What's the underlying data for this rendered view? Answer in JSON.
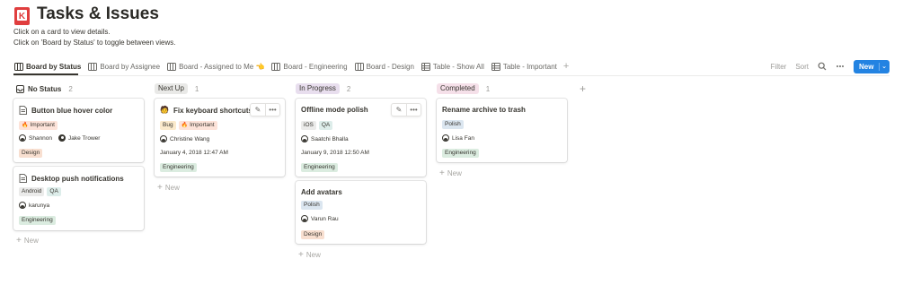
{
  "page": {
    "icon": "kanban-board-icon",
    "title": "Tasks & Issues",
    "description_lines": [
      "Click on a card to view details.",
      "Click on 'Board by Status' to toggle between views."
    ]
  },
  "tabs": [
    {
      "label": "Board by Status",
      "icon": "board-icon",
      "active": true
    },
    {
      "label": "Board by Assignee",
      "icon": "board-icon"
    },
    {
      "label": "Board - Assigned to Me 👈",
      "icon": "board-icon"
    },
    {
      "label": "Board - Engineering",
      "icon": "board-icon"
    },
    {
      "label": "Board - Design",
      "icon": "board-icon"
    },
    {
      "label": "Table - Show All",
      "icon": "table-icon"
    },
    {
      "label": "Table - Important",
      "icon": "table-icon"
    }
  ],
  "toolbar": {
    "filter": "Filter",
    "sort": "Sort",
    "search_icon": "search-icon",
    "more_icon": "more-icon",
    "new_label": "New"
  },
  "columns": [
    {
      "name": "No Status",
      "count": "2"
    },
    {
      "name": "Next Up",
      "count": "1"
    },
    {
      "name": "In Progress",
      "count": "2"
    },
    {
      "name": "Completed",
      "count": "1"
    }
  ],
  "new_card_label": "New",
  "cards": {
    "blue_hover": {
      "title": "Button blue hover color",
      "tag": "Important",
      "people": [
        "Shannon",
        "Jake Trower"
      ],
      "team": "Design"
    },
    "push": {
      "title": "Desktop push notifications",
      "tags": [
        "Android",
        "QA"
      ],
      "person": "karunya",
      "team": "Engineering"
    },
    "keyboard": {
      "title": "Fix keyboard shortcuts",
      "tags": [
        "Bug",
        "Important"
      ],
      "person": "Christine Wang",
      "date": "January 4, 2018 12:47 AM",
      "team": "Engineering"
    },
    "offline": {
      "title": "Offline mode polish",
      "tags": [
        "iOS",
        "QA"
      ],
      "person": "Saatchi Bhalla",
      "date": "January 9, 2018 12:50 AM",
      "team": "Engineering"
    },
    "avatars": {
      "title": "Add avatars",
      "tag": "Polish",
      "person": "Varun Rau",
      "team": "Design"
    },
    "archive": {
      "title": "Rename archive to trash",
      "tag": "Polish",
      "person": "Lisa Fan",
      "team": "Engineering"
    }
  },
  "colors": {
    "accent": "#2383e2",
    "text": "#37352f"
  }
}
